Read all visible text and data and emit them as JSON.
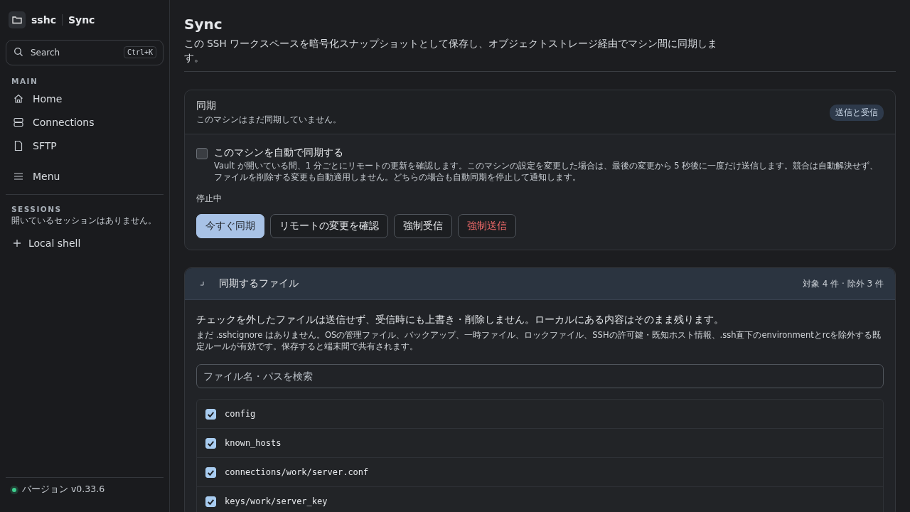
{
  "sidebar": {
    "app": "sshc",
    "page": "Sync",
    "search": {
      "placeholder": "Search",
      "shortcut": "Ctrl+K"
    },
    "main_heading": "MAIN",
    "items": [
      {
        "kind": "home",
        "label": "Home"
      },
      {
        "kind": "connections",
        "label": "Connections"
      },
      {
        "kind": "sftp",
        "label": "SFTP"
      },
      {
        "kind": "menu",
        "label": "Menu"
      }
    ],
    "sessions_heading": "SESSIONS",
    "sessions_empty": "開いているセッションはありません。",
    "local_shell": "Local shell",
    "version": {
      "text": "バージョン v0.33.6",
      "color": "#3ecf8e"
    }
  },
  "page": {
    "title": "Sync",
    "description": "この SSH ワークスペースを暗号化スナップショットとして保存し、オブジェクトストレージ経由でマシン間に同期します。"
  },
  "sync_card": {
    "title": "同期",
    "subtitle": "このマシンはまだ同期していません。",
    "badge": "送信と受信",
    "auto_sync": {
      "label": "このマシンを自動で同期する",
      "checked": false,
      "help": "Vault が開いている間、1 分ごとにリモートの更新を確認します。このマシンの設定を変更した場合は、最後の変更から 5 秒後に一度だけ送信します。競合は自動解決せず、ファイルを削除する変更も自動適用しません。どちらの場合も自動同期を停止して通知します。"
    },
    "status": "停止中",
    "buttons": [
      {
        "kind": "primary",
        "label": "今すぐ同期"
      },
      {
        "kind": "normal",
        "label": "リモートの変更を確認"
      },
      {
        "kind": "normal",
        "label": "強制受信"
      },
      {
        "kind": "danger",
        "label": "強制送信"
      }
    ]
  },
  "files_card": {
    "title": "同期するファイル",
    "expanded": true,
    "counts": "対象 4 件 · 除外 3 件",
    "note": "チェックを外したファイルは送信せず、受信時にも上書き・削除しません。ローカルにある内容はそのまま残ります。",
    "detail": "まだ .sshcignore はありません。OSの管理ファイル、バックアップ、一時ファイル、ロックファイル、SSHの許可鍵・既知ホスト情報、.ssh直下のenvironmentとrcを除外する既定ルールが有効です。保存すると端末間で共有されます。",
    "search": {
      "placeholder": "ファイル名・パスを検索"
    },
    "files": [
      {
        "path": "config",
        "checked": true
      },
      {
        "path": "known_hosts",
        "checked": true
      },
      {
        "path": "connections/work/server.conf",
        "checked": true
      },
      {
        "path": "keys/work/server_key",
        "checked": true
      }
    ]
  }
}
